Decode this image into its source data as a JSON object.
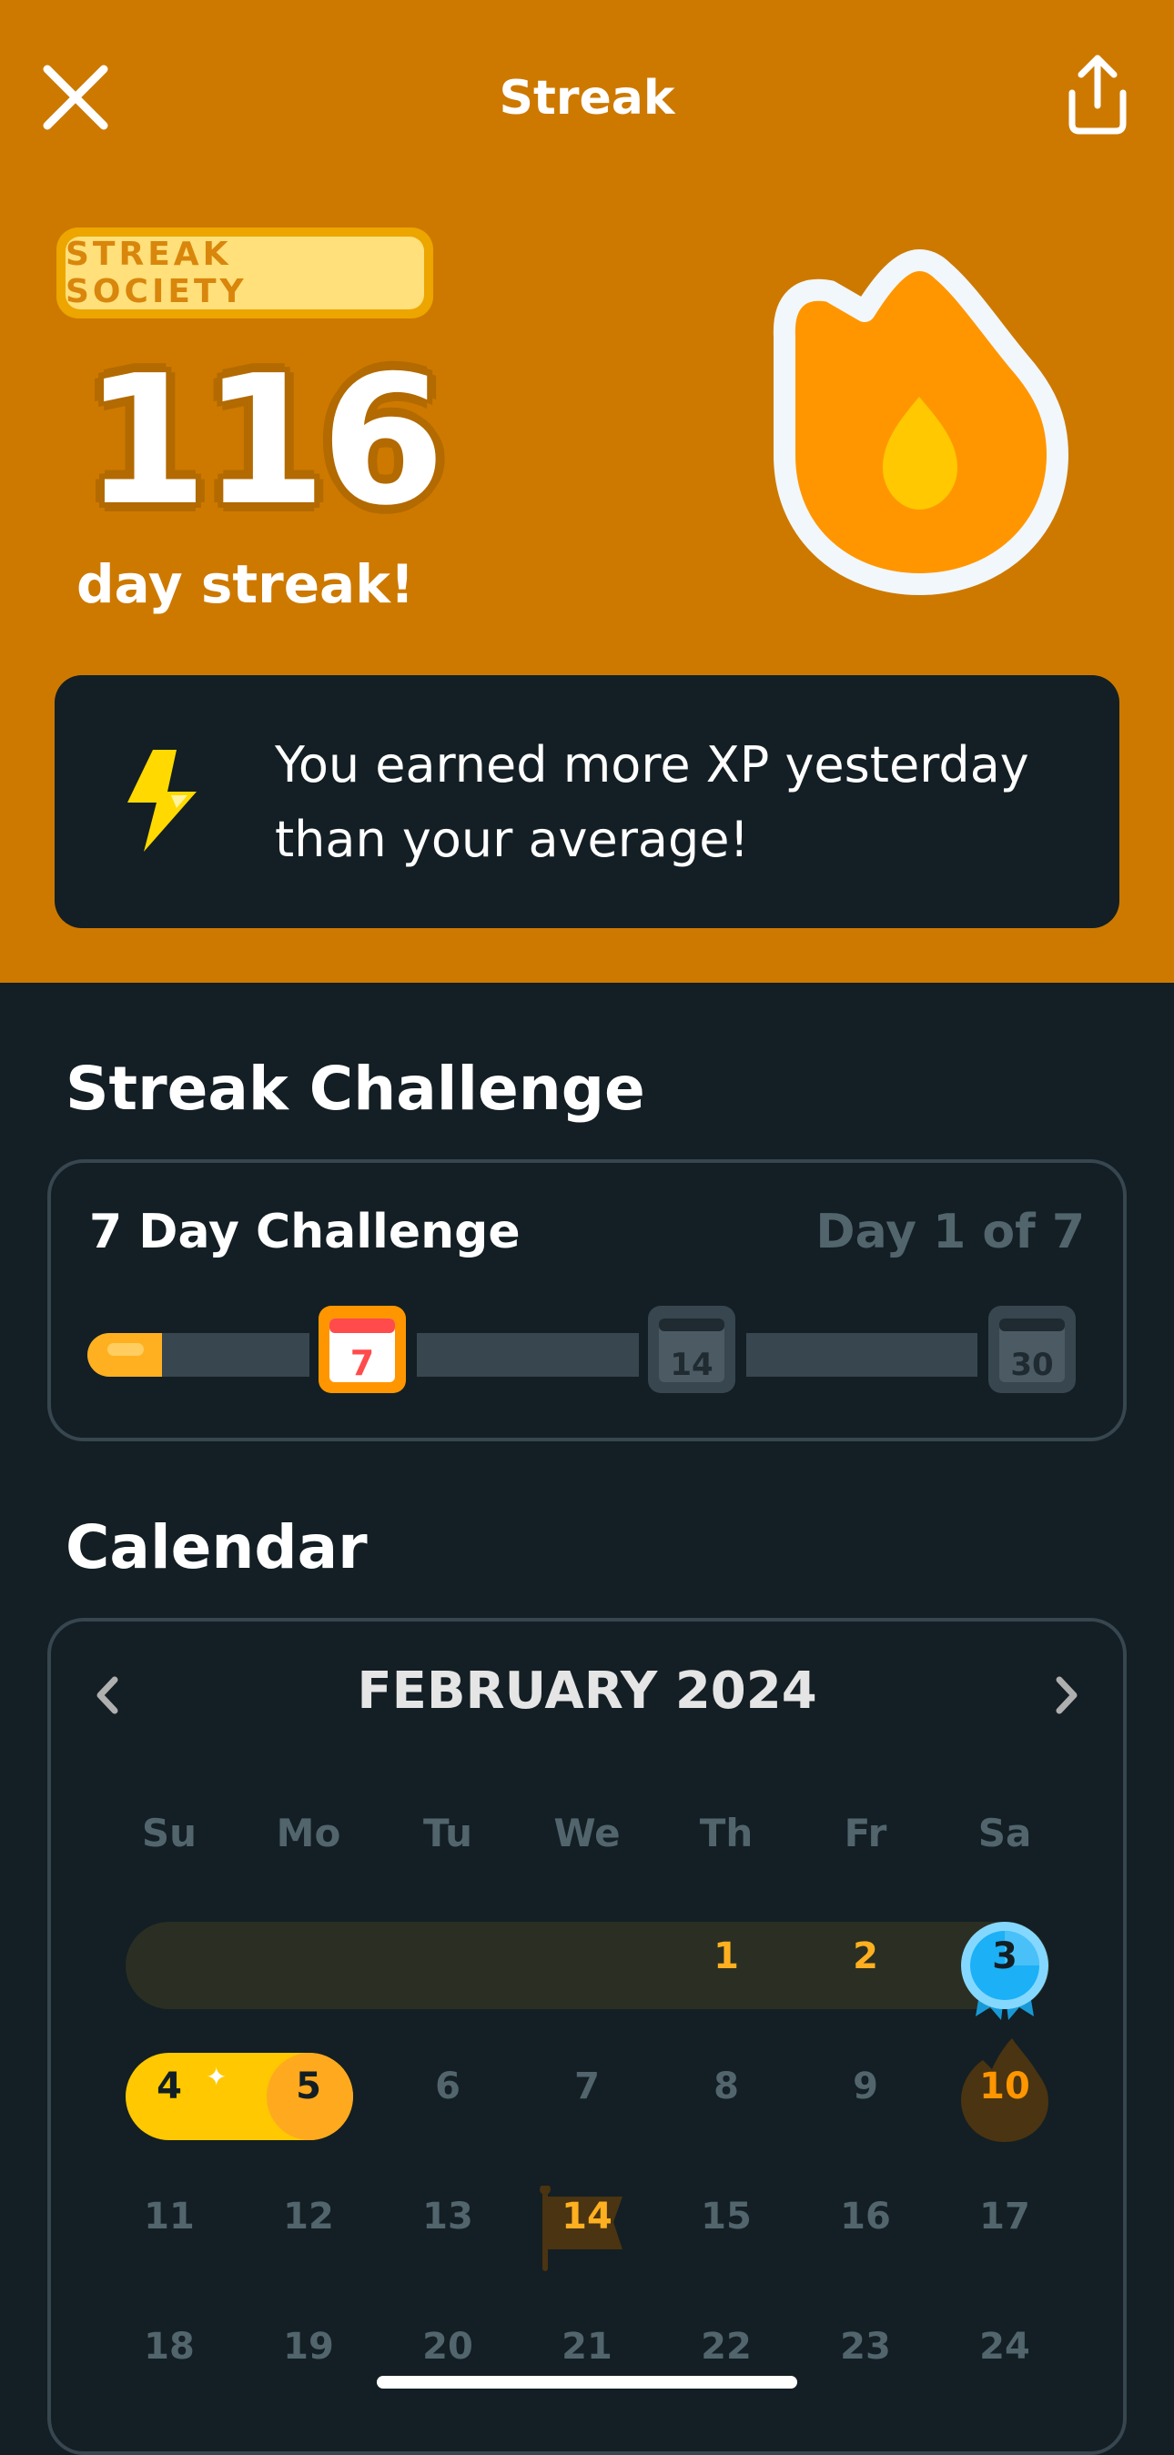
{
  "header": {
    "title": "Streak",
    "close_icon": "close-icon",
    "share_icon": "share-icon"
  },
  "streak": {
    "badge": "STREAK SOCIETY",
    "count": "116",
    "label": "day streak!",
    "flame_icon": "flame-icon"
  },
  "xp_card": {
    "icon": "lightning-bolt-icon",
    "message": "You earned more XP yesterday than your average!"
  },
  "challenge": {
    "section_title": "Streak Challenge",
    "name": "7 Day Challenge",
    "progress": "Day 1 of 7",
    "progress_fraction": 0.143,
    "milestones": [
      "7",
      "14",
      "30"
    ]
  },
  "calendar": {
    "section_title": "Calendar",
    "month": "FEBRUARY 2024",
    "weekdays": [
      "Su",
      "Mo",
      "Tu",
      "We",
      "Th",
      "Fr",
      "Sa"
    ],
    "rows": [
      [
        "",
        "",
        "",
        "",
        "1",
        "2",
        "3"
      ],
      [
        "4",
        "5",
        "6",
        "7",
        "8",
        "9",
        "10"
      ],
      [
        "11",
        "12",
        "13",
        "14",
        "15",
        "16",
        "17"
      ],
      [
        "18",
        "19",
        "20",
        "21",
        "22",
        "23",
        "24"
      ]
    ]
  },
  "colors": {
    "hero": "#cd7900",
    "background": "#131f24",
    "accent_gold": "#ffb020",
    "accent_blue": "#1cb0f6",
    "muted": "#52656d"
  }
}
